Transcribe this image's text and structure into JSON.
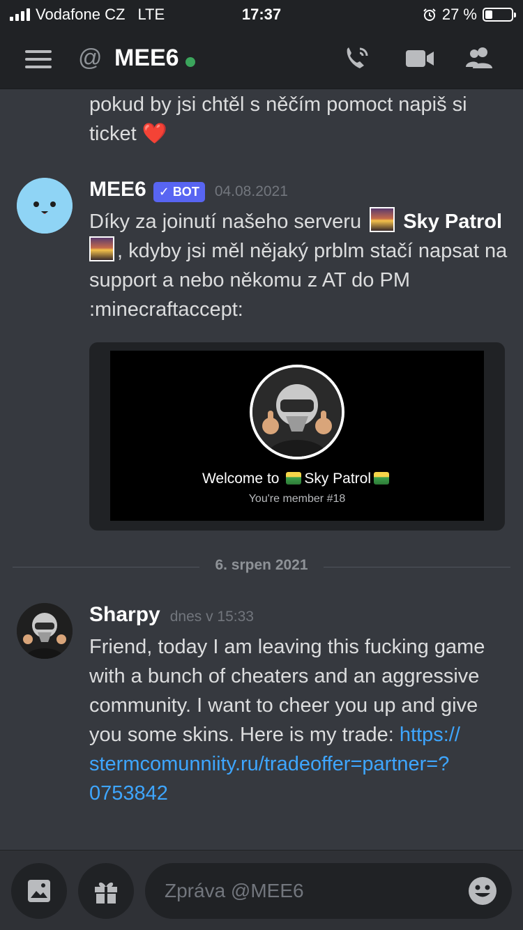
{
  "status_bar": {
    "carrier": "Vodafone CZ",
    "network": "LTE",
    "time": "17:37",
    "battery_percent": "27 %",
    "battery_level": 0.27
  },
  "header": {
    "channel_name": "MEE6",
    "at_symbol": "@",
    "icons": [
      "menu-icon",
      "at-icon",
      "call-icon",
      "video-icon",
      "members-icon"
    ]
  },
  "messages": {
    "previous_tail": "pokud by jsi chtěl s něčím pomoct napiš si ticket",
    "previous_tail_emoji": "❤️",
    "mee6": {
      "author": "MEE6",
      "bot_tag": "BOT",
      "bot_check": "✓",
      "timestamp": "04.08.2021",
      "text_before": "Díky za joinutí našeho serveru",
      "server_name": "Sky Patrol",
      "text_after": ", kdyby jsi měl nějaký prblm stačí napsat na support a nebo někomu z AT do PM  :minecraftaccept:",
      "embed": {
        "welcome_prefix": "Welcome to",
        "welcome_server": "Sky Patrol",
        "member_line": "You're member #18"
      }
    },
    "date_divider": "6. srpen 2021",
    "sharpy": {
      "author": "Sharpy",
      "timestamp": "dnes v 15:33",
      "text": "Friend, today I am leaving this fucking game with a bunch of cheaters and an aggressive community. I want to cheer you up and give you some skins. Here is my trade:",
      "link": "https:// stermcomunniity.ru/tradeoffer=partner=? 0753842"
    }
  },
  "composer": {
    "placeholder": "Zpráva @MEE6",
    "icons": [
      "image-icon",
      "gift-icon",
      "emoji-icon"
    ]
  },
  "colors": {
    "background": "#36393f",
    "header": "#202225",
    "bot_tag": "#5865f2",
    "online": "#3ba55c",
    "link": "#3ea6ff",
    "mee6_avatar": "#8fd4f5"
  }
}
